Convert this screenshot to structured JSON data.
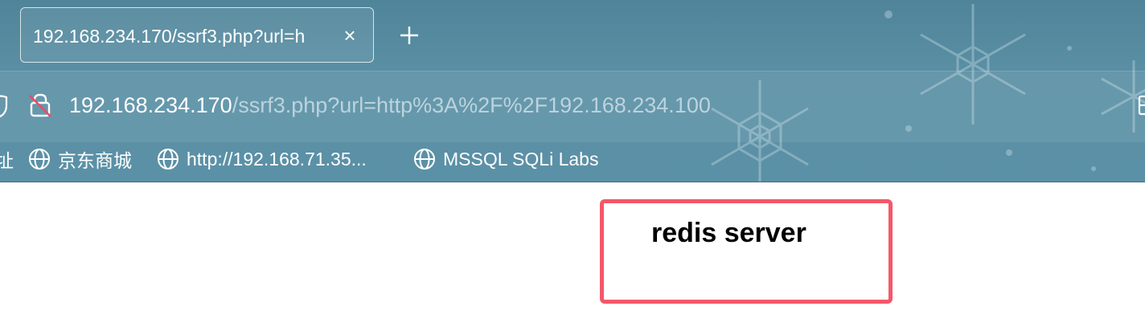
{
  "tab": {
    "title": "192.168.234.170/ssrf3.php?url=h",
    "close_symbol": "×",
    "new_tab_symbol": "+"
  },
  "address": {
    "host": "192.168.234.170",
    "path": "/ssrf3.php?url=http%3A%2F%2F192.168.234.100"
  },
  "bookmarks": {
    "partial_label": "址",
    "items": [
      {
        "label": "京东商城",
        "icon": "globe-icon"
      },
      {
        "label": "http://192.168.71.35...",
        "icon": "globe-icon"
      },
      {
        "label": "MSSQL SQLi Labs",
        "icon": "globe-icon"
      }
    ]
  },
  "page": {
    "text": "redis server"
  },
  "colors": {
    "chrome": "#5a8fa4",
    "highlight": "#f4576a"
  }
}
